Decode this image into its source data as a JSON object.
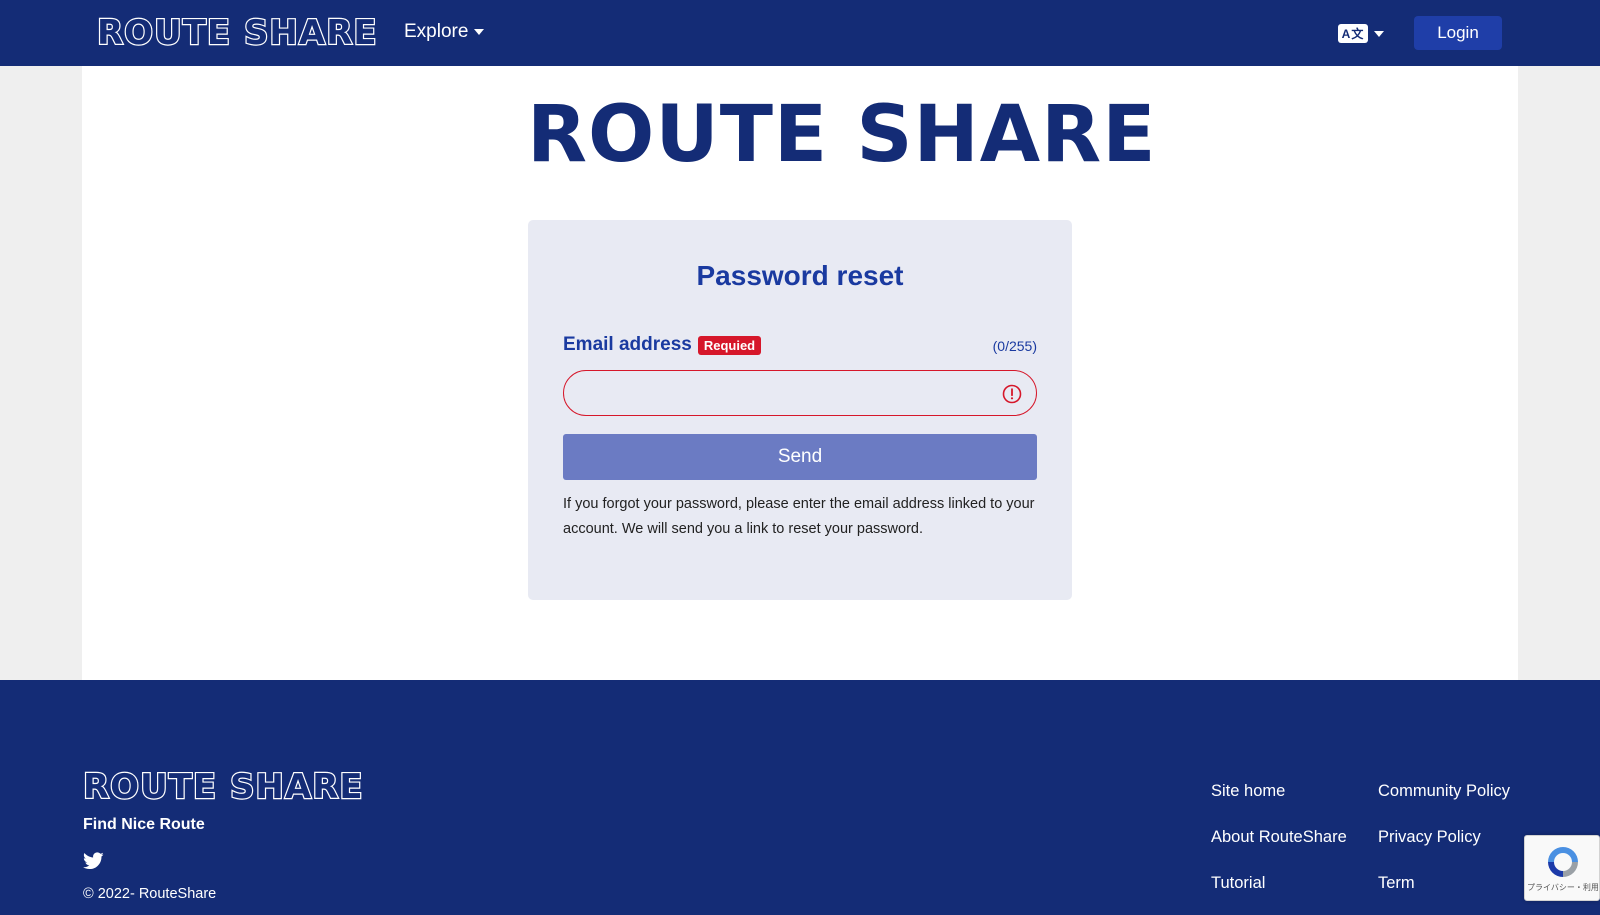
{
  "header": {
    "logo": "ROUTE SHARE",
    "explore_label": "Explore",
    "lang_icon_text": "A文",
    "login_label": "Login"
  },
  "main": {
    "hero_logo": "ROUTE SHARE",
    "form": {
      "title": "Password reset",
      "email_label": "Email address",
      "required_badge": "Requied",
      "counter": "(0/255)",
      "email_value": "",
      "send_label": "Send",
      "help_text": "If you forgot your password, please enter the email address linked to your account. We will send you a link to reset your password."
    }
  },
  "footer": {
    "logo": "ROUTE SHARE",
    "tagline": "Find Nice Route",
    "copyright": "© 2022- RouteShare",
    "links": {
      "site_home": "Site home",
      "about": "About RouteShare",
      "tutorial": "Tutorial",
      "community_policy": "Community Policy",
      "privacy_policy": "Privacy Policy",
      "term": "Term"
    }
  },
  "recaptcha": {
    "text": "プライバシー・利用規約"
  },
  "colors": {
    "nav_bg": "#142c76",
    "accent": "#1a3aa0",
    "login_btn": "#1f3ea8",
    "send_btn": "#6b7bc3",
    "error": "#d6172a",
    "card_bg": "#e8eaf3"
  },
  "icons": {
    "explore_caret": "chevron-down-icon",
    "language": "translate-icon",
    "input_error": "alert-circle-icon",
    "social": "twitter-icon",
    "captcha": "recaptcha-icon"
  }
}
